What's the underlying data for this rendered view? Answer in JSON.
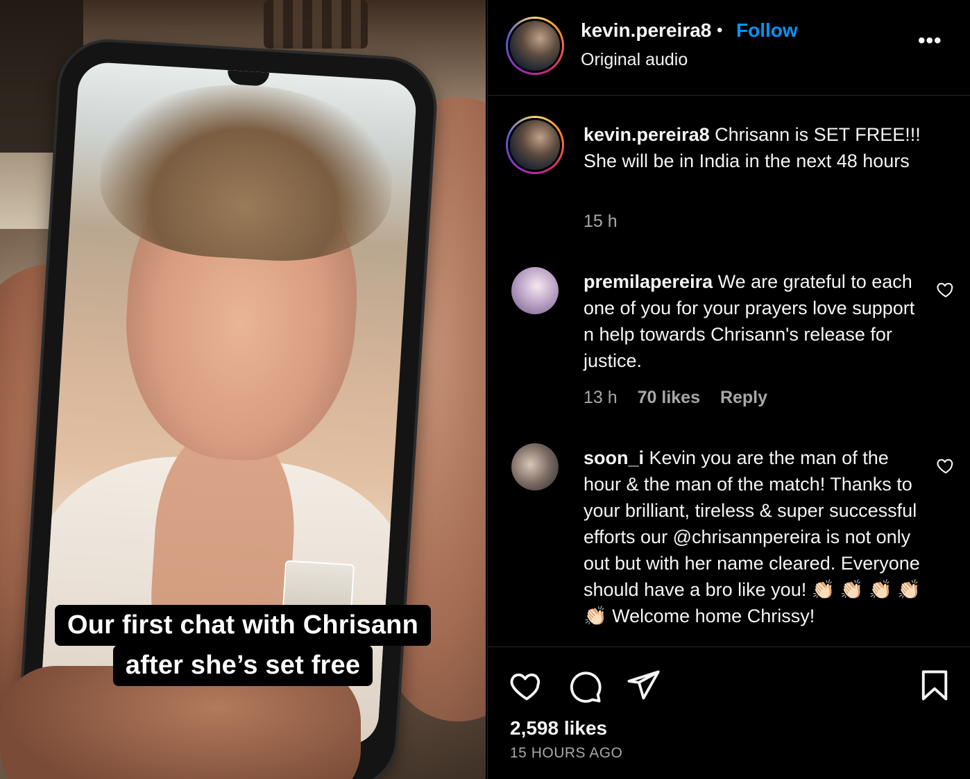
{
  "video": {
    "caption_line1": "Our first chat with Chrisann",
    "caption_line2": "after she’s set free"
  },
  "header": {
    "username": "kevin.pereira8",
    "separator": "•",
    "follow_label": "Follow",
    "audio_label": "Original audio",
    "more_icon": "•••"
  },
  "post_caption": {
    "username": "kevin.pereira8",
    "text": " Chrisann is SET FREE!!! She will be in India in the next 48 hours",
    "time": "15 h"
  },
  "comments": [
    {
      "username": "premilapereira",
      "text": " We are grateful to each one of you for your prayers love support n help towards Chrisann's release for justice.",
      "time": "13 h",
      "likes": "70 likes",
      "reply": "Reply"
    },
    {
      "username": "soon_i",
      "text": " Kevin you are the man of the hour & the man of the match! Thanks to your brilliant, tireless & super successful efforts our @chrisannpereira is not only out but with her name cleared. Everyone should have a bro like you! 👏🏻 👏🏻 👏🏻 👏🏻 👏🏻 Welcome home Chrissy!"
    }
  ],
  "footer": {
    "likes": "2,598 likes",
    "time_ago": "15 HOURS AGO"
  },
  "colors": {
    "follow": "#0095f6",
    "secondary_text": "#a8a8a8",
    "background": "#000000"
  }
}
